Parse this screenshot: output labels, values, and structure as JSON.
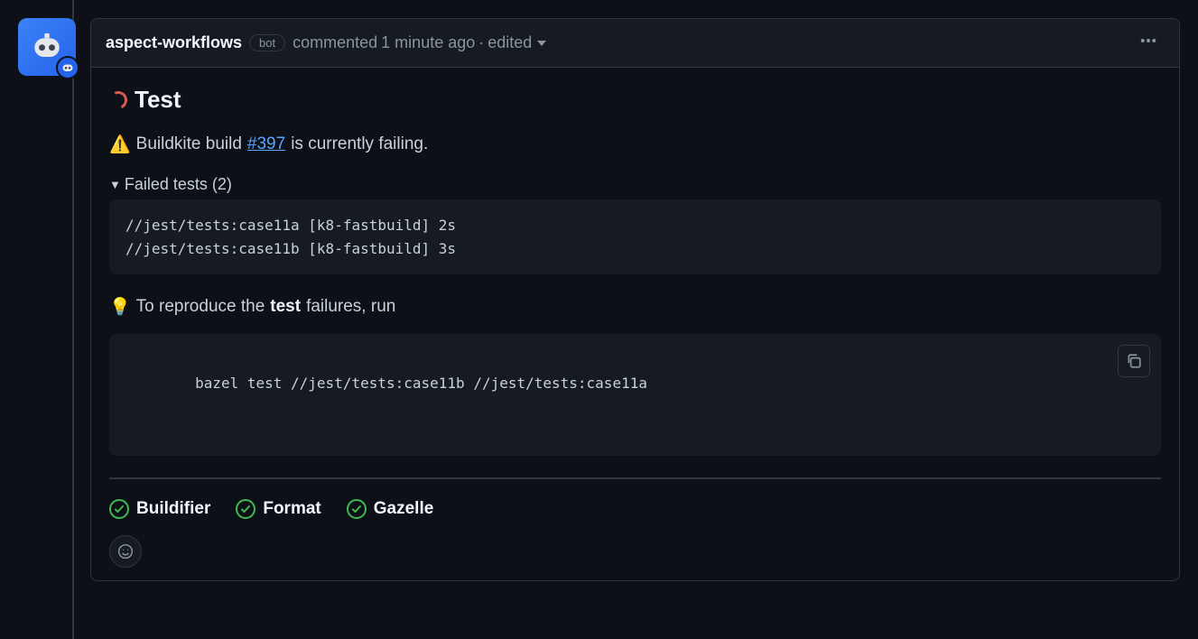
{
  "header": {
    "author": "aspect-workflows",
    "bot_label": "bot",
    "commented": "commented",
    "timestamp": "1 minute ago",
    "sep": "·",
    "edited": "edited"
  },
  "title": "Test",
  "warning": {
    "prefix": "Buildkite build",
    "build_link": "#397",
    "suffix": "is currently failing."
  },
  "failed_tests": {
    "summary": "Failed tests (2)",
    "lines": [
      "//jest/tests:case11a [k8-fastbuild] 2s",
      "//jest/tests:case11b [k8-fastbuild] 3s"
    ]
  },
  "reproduce": {
    "prefix": "To reproduce the",
    "bold": "test",
    "suffix": "failures, run"
  },
  "command": "bazel test //jest/tests:case11b //jest/tests:case11a",
  "statuses": [
    {
      "label": "Buildifier"
    },
    {
      "label": "Format"
    },
    {
      "label": "Gazelle"
    }
  ]
}
